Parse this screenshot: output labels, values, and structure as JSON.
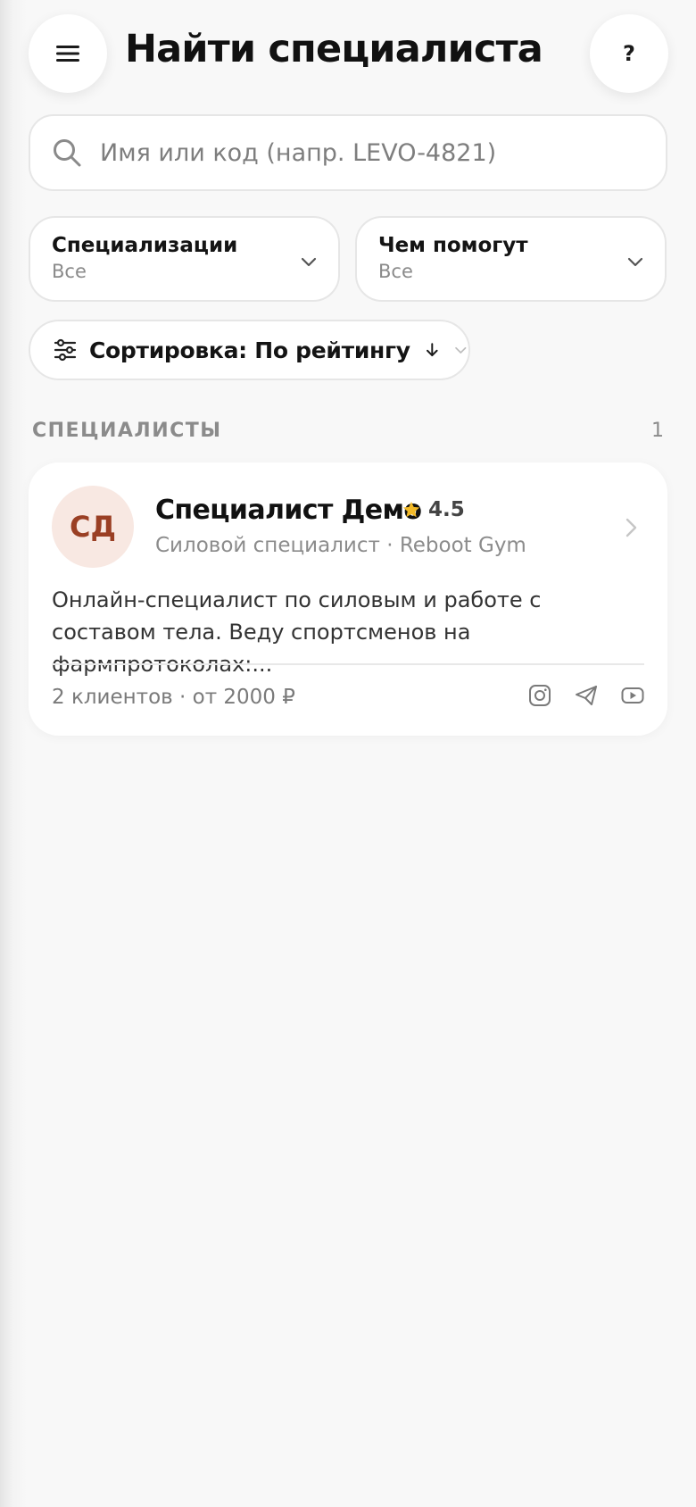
{
  "header": {
    "title": "Найти специалиста",
    "menu_icon": "menu-icon",
    "help_label": "?"
  },
  "search": {
    "placeholder": "Имя или код (напр. LEVO-4821)",
    "value": ""
  },
  "filters": [
    {
      "label": "Специализации",
      "value": "Все"
    },
    {
      "label": "Чем помогут",
      "value": "Все"
    }
  ],
  "sort": {
    "label": "Сортировка: По рейтингу",
    "direction_icon": "arrow-down-icon"
  },
  "section": {
    "title": "СПЕЦИАЛИСТЫ",
    "count": "1"
  },
  "specialists": [
    {
      "initials": "СД",
      "name": "Специалист Демо",
      "rating": "4.5",
      "subtitle": "Силовой специалист · Reboot Gym",
      "description": "Онлайн-специалист по силовым и работе с составом тела. Веду спортсменов на фармпротоколах:...",
      "meta": "2 клиентов · от 2000 ₽",
      "socials": [
        "instagram-icon",
        "telegram-icon",
        "youtube-icon"
      ]
    }
  ],
  "colors": {
    "background": "#f8f8f8",
    "star": "#f2b928",
    "avatar_bg": "#f8e8e2",
    "avatar_text": "#9a3f24"
  }
}
